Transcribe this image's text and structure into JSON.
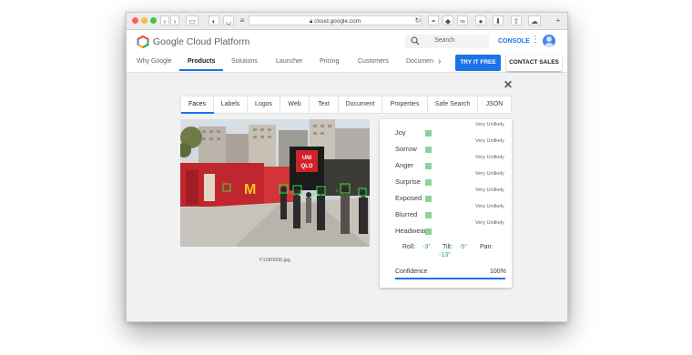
{
  "browser": {
    "url": "cloud.google.com",
    "lock_icon": "lock-icon",
    "traffic_lights": {
      "close": "#fc605b",
      "minimize": "#fdbc40",
      "maximize": "#34c84a"
    }
  },
  "header": {
    "brand": "Google Cloud Platform",
    "search_placeholder": "Search",
    "console_label": "CONSOLE",
    "colors": {
      "accent": "#1a73e8"
    }
  },
  "nav": {
    "items": [
      {
        "label": "Why Google",
        "active": false
      },
      {
        "label": "Products",
        "active": true
      },
      {
        "label": "Solutions",
        "active": false
      },
      {
        "label": "Launcher",
        "active": false
      },
      {
        "label": "Pricing",
        "active": false
      },
      {
        "label": "Customers",
        "active": false
      },
      {
        "label": "Documen",
        "active": false
      }
    ],
    "more_icon": "chevron-right-icon",
    "try_label": "TRY IT FREE",
    "contact_label": "CONTACT SALES"
  },
  "vision": {
    "close_icon": "close-icon",
    "tabs": [
      "Faces",
      "Labels",
      "Logos",
      "Web",
      "Text",
      "Document",
      "Properties",
      "Safe Search",
      "JSON"
    ],
    "active_tab": "Faces",
    "image_caption": "F1080006.jpg",
    "photo_sign": "UNI QLO",
    "likelihoods": [
      {
        "label": "Joy",
        "value": "Very Unlikely"
      },
      {
        "label": "Sorrow",
        "value": "Very Unlikely"
      },
      {
        "label": "Anger",
        "value": "Very Unlikely"
      },
      {
        "label": "Surprise",
        "value": "Very Unlikely"
      },
      {
        "label": "Exposed",
        "value": "Very Unlikely"
      },
      {
        "label": "Blurred",
        "value": "Very Unlikely"
      },
      {
        "label": "Headwear",
        "value": "Very Unlikely"
      }
    ],
    "likelihood_color": "#8fd19e",
    "roll_label": "Roll:",
    "roll_value": "-3°",
    "tilt_label": "Tilt:",
    "tilt_value": "-5°",
    "pan_label": "Pan:",
    "pan_value": "-13°",
    "confidence_label": "Confidence",
    "confidence_value": "100%",
    "confidence_fraction": 1.0
  }
}
